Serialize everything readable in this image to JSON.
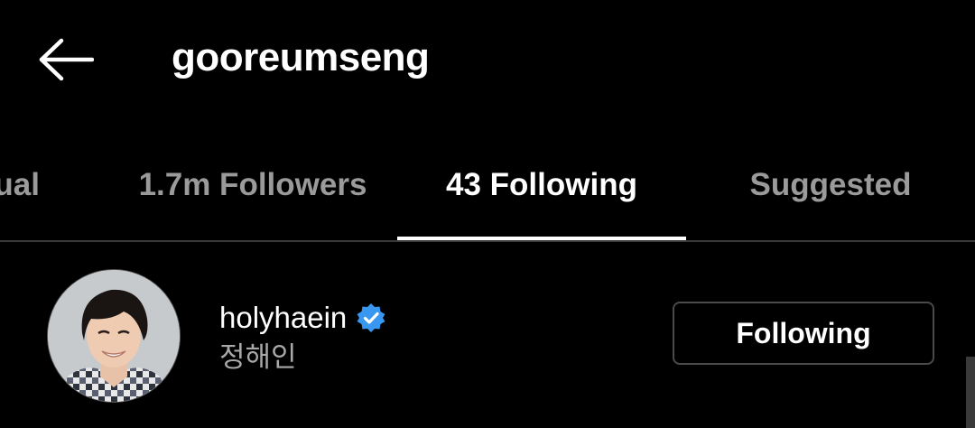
{
  "header": {
    "back_icon": "arrow-left-icon",
    "title": "gooreumseng"
  },
  "tabs": [
    {
      "label": "Mutual",
      "visible_text": "ual",
      "active": false
    },
    {
      "label": "1.7m Followers",
      "active": false
    },
    {
      "label": "43 Following",
      "active": true
    },
    {
      "label": "Suggested",
      "active": false
    }
  ],
  "list": {
    "items": [
      {
        "username": "holyhaein",
        "verified_icon": "verified-badge-icon",
        "full_name": "정해인",
        "button_label": "Following"
      }
    ]
  },
  "colors": {
    "background": "#000000",
    "text_primary": "#ffffff",
    "text_secondary": "#9a9a9a",
    "verified": "#3897f0",
    "button_border": "#4a4a4a"
  }
}
